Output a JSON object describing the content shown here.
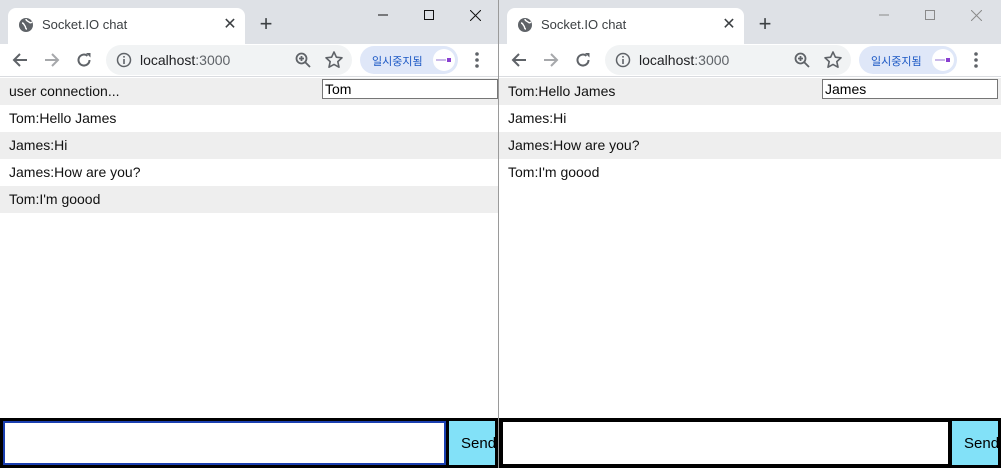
{
  "tab_title": "Socket.IO chat",
  "url_host": "localhost",
  "url_port": ":3000",
  "profile_label": "일시중지됨",
  "send_label": "Send",
  "colors": {
    "tab_strip": "#dee1e6",
    "row_alt": "#eeeeee",
    "send_button": "#82e1f8",
    "form_background": "#000000"
  },
  "windows": [
    {
      "username": "Tom",
      "messages": [
        "user connection...",
        "Tom:Hello James",
        "James:Hi",
        "James:How are you?",
        "Tom:I'm goood"
      ],
      "message_input": ""
    },
    {
      "username": "James",
      "messages": [
        "Tom:Hello James",
        "James:Hi",
        "James:How are you?",
        "Tom:I'm goood"
      ],
      "message_input": ""
    }
  ]
}
